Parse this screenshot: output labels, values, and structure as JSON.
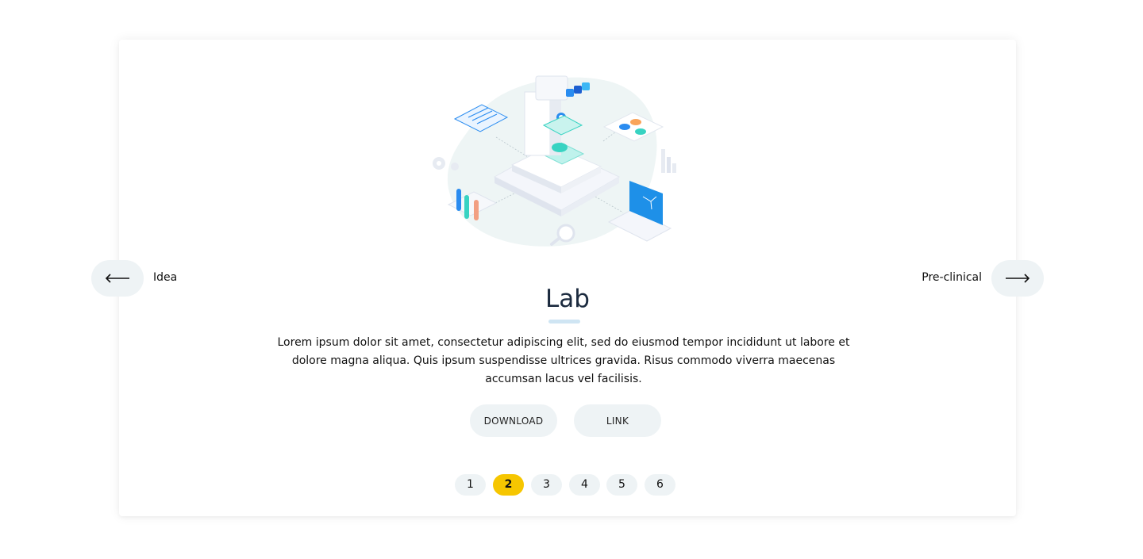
{
  "prev": {
    "label": "Idea",
    "icon": "arrow-left-icon"
  },
  "next": {
    "label": "Pre-clinical",
    "icon": "arrow-right-icon"
  },
  "title": "Lab",
  "description": "Lorem ipsum dolor sit amet, consectetur adipiscing elit, sed do eiusmod tempor incididunt ut labore et dolore magna aliqua. Quis ipsum suspendisse ultrices gravida. Risus commodo viverra maecenas accumsan lacus vel facilisis.",
  "buttons": {
    "download": "DOWNLOAD",
    "link": "LINK"
  },
  "pagination": {
    "items": [
      "1",
      "2",
      "3",
      "4",
      "5",
      "6"
    ],
    "active": "2"
  },
  "colors": {
    "accent": "#f6c600",
    "pill_bg": "#eef3f5",
    "title": "#1b2a3e",
    "underline": "#cfe5f3",
    "illustration_teal": "#38d3c2",
    "illustration_blue": "#2a8cf0"
  },
  "illustration": {
    "icon": "lab-microscope-illustration"
  }
}
